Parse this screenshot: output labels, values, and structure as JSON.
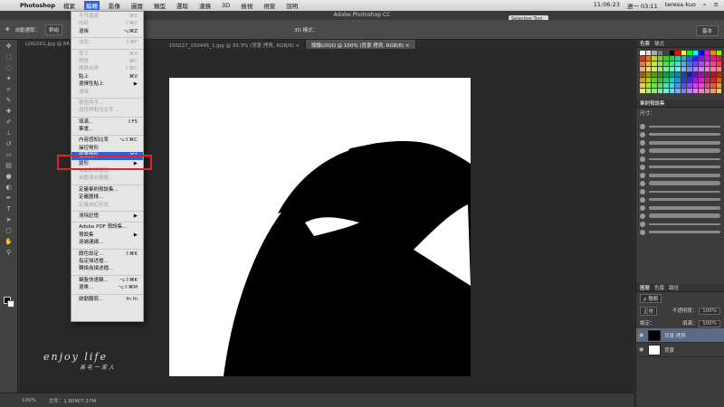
{
  "macbar": {
    "app_name": "Photoshop",
    "menus": [
      "檔案",
      "編輯",
      "影像",
      "圖層",
      "類型",
      "選取",
      "濾鏡",
      "3D",
      "檢視",
      "視窗",
      "說明"
    ],
    "clock": "週一 03:11",
    "time": "11:06:23",
    "user": "teresa kuo",
    "tab_hint": "Teresa"
  },
  "window": {
    "title": "Adobe Photoshop CC",
    "selection_tool": "Selective Tool"
  },
  "options": {
    "auto_select": "自動選取：",
    "layer": "群組",
    "mode_3d": "3D 模式：",
    "workspace": "基本"
  },
  "doc_tabs": [
    "LOGO01.jpg @ 66.7...",
    "150227_150445_1.jpg @ 33.3% (背景 拷貝, RGB/8) ×",
    "頭像LOGO @ 100% (背景 拷貝, RGB/8) ×"
  ],
  "edit_menu": [
    {
      "label": "不可還原",
      "key": "⌘Z",
      "dis": true
    },
    {
      "label": "向前",
      "key": "⇧⌘Z",
      "dis": true
    },
    {
      "label": "退後",
      "key": "⌥⌘Z",
      "dis": false
    },
    {
      "sep": true
    },
    {
      "label": "淡化...",
      "key": "⇧⌘F",
      "dis": true
    },
    {
      "sep": true
    },
    {
      "label": "剪下",
      "key": "⌘X",
      "dis": true
    },
    {
      "label": "拷貝",
      "key": "⌘C",
      "dis": true
    },
    {
      "label": "拷貝合併",
      "key": "⇧⌘C",
      "dis": true
    },
    {
      "label": "貼上",
      "key": "⌘V",
      "dis": false
    },
    {
      "label": "選擇性貼上",
      "key": "▶",
      "dis": false
    },
    {
      "label": "清除",
      "key": "",
      "dis": true
    },
    {
      "sep": true
    },
    {
      "label": "檢查拼字...",
      "key": "",
      "dis": true
    },
    {
      "label": "尋找與取代文字...",
      "key": "",
      "dis": true
    },
    {
      "sep": true
    },
    {
      "label": "填滿...",
      "key": "⇧F5",
      "dis": false
    },
    {
      "label": "筆畫...",
      "key": "",
      "dis": false
    },
    {
      "sep": true
    },
    {
      "label": "內容感知比率",
      "key": "⌥⇧⌘C",
      "dis": false
    },
    {
      "label": "操控彎形",
      "key": "",
      "dis": false
    },
    {
      "label": "任意變形",
      "key": "⌘T",
      "dis": false,
      "hl": true
    },
    {
      "label": "變形",
      "key": "▶",
      "dis": false
    },
    {
      "label": "自動對齊圖層...",
      "key": "",
      "dis": true
    },
    {
      "label": "自動混合圖層...",
      "key": "",
      "dis": true
    },
    {
      "sep": true
    },
    {
      "label": "定義筆刷預設集...",
      "key": "",
      "dis": false
    },
    {
      "label": "定義圖樣...",
      "key": "",
      "dis": false
    },
    {
      "label": "定義自訂形狀...",
      "key": "",
      "dis": true
    },
    {
      "sep": true
    },
    {
      "label": "清除記憶",
      "key": "▶",
      "dis": false
    },
    {
      "sep": true
    },
    {
      "label": "Adobe PDF 預設集...",
      "key": "",
      "dis": false
    },
    {
      "label": "預設集",
      "key": "▶",
      "dis": false
    },
    {
      "label": "遠端連線...",
      "key": "",
      "dis": false
    },
    {
      "sep": true
    },
    {
      "label": "顏色設定...",
      "key": "⇧⌘K",
      "dis": false
    },
    {
      "label": "指定描述檔...",
      "key": "",
      "dis": false
    },
    {
      "label": "轉換為描述檔...",
      "key": "",
      "dis": false
    },
    {
      "sep": true
    },
    {
      "label": "鍵盤快速鍵...",
      "key": "⌥⇧⌘K",
      "dis": false
    },
    {
      "label": "選單...",
      "key": "⌥⇧⌘M",
      "dis": false
    },
    {
      "sep": true
    },
    {
      "label": "啟動聽寫...",
      "key": "fn fn",
      "dis": false
    }
  ],
  "panels": {
    "swatch_tabs": [
      "色票",
      "樣式"
    ],
    "brush_tabs": [
      "筆刷預設集"
    ],
    "brush_size_label": "尺寸：",
    "layer_tabs": [
      "圖層",
      "色版",
      "路徑"
    ],
    "filter_label": "ρ 種類",
    "blend_mode": "正常",
    "opacity_label": "不透明度：",
    "opacity": "100%",
    "lock_label": "鎖定：",
    "fill_label": "填滿：",
    "fill": "100%",
    "layers": [
      {
        "name": "背景 拷貝",
        "selected": true,
        "dark": true
      },
      {
        "name": "背景",
        "selected": false,
        "dark": false
      }
    ]
  },
  "status": {
    "zoom": "100%",
    "doc_info": "文件：1.80M/7.37M"
  },
  "watermark": {
    "main": "enjoy life",
    "sub": "長毛一家人"
  },
  "colors": {
    "menu_highlight": "#2f62d9",
    "annotation": "#e32227",
    "selected_layer": "#5b6b86"
  }
}
